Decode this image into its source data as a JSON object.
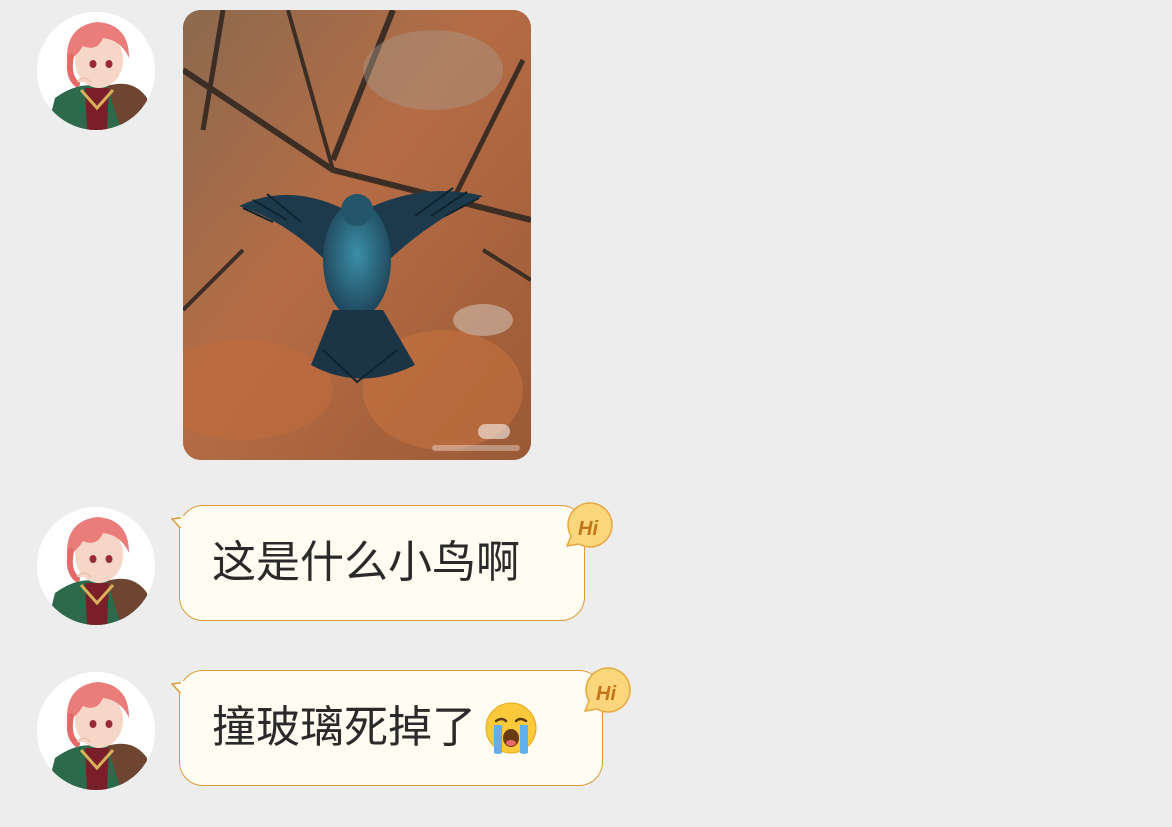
{
  "messages": [
    {
      "type": "image",
      "sender": "other"
    },
    {
      "type": "text",
      "sender": "other",
      "text": "这是什么小鸟啊"
    },
    {
      "type": "text",
      "sender": "other",
      "text": "撞玻璃死掉了",
      "emoji": "loudly-crying-face-emoji"
    }
  ],
  "bubble_badge": {
    "label": "Hi"
  },
  "colors": {
    "background": "#ededed",
    "bubble_fill": "#fffcf2",
    "bubble_border": "#dc9b3a",
    "badge_fill": "#fbd67a",
    "badge_text": "#c4741a"
  }
}
